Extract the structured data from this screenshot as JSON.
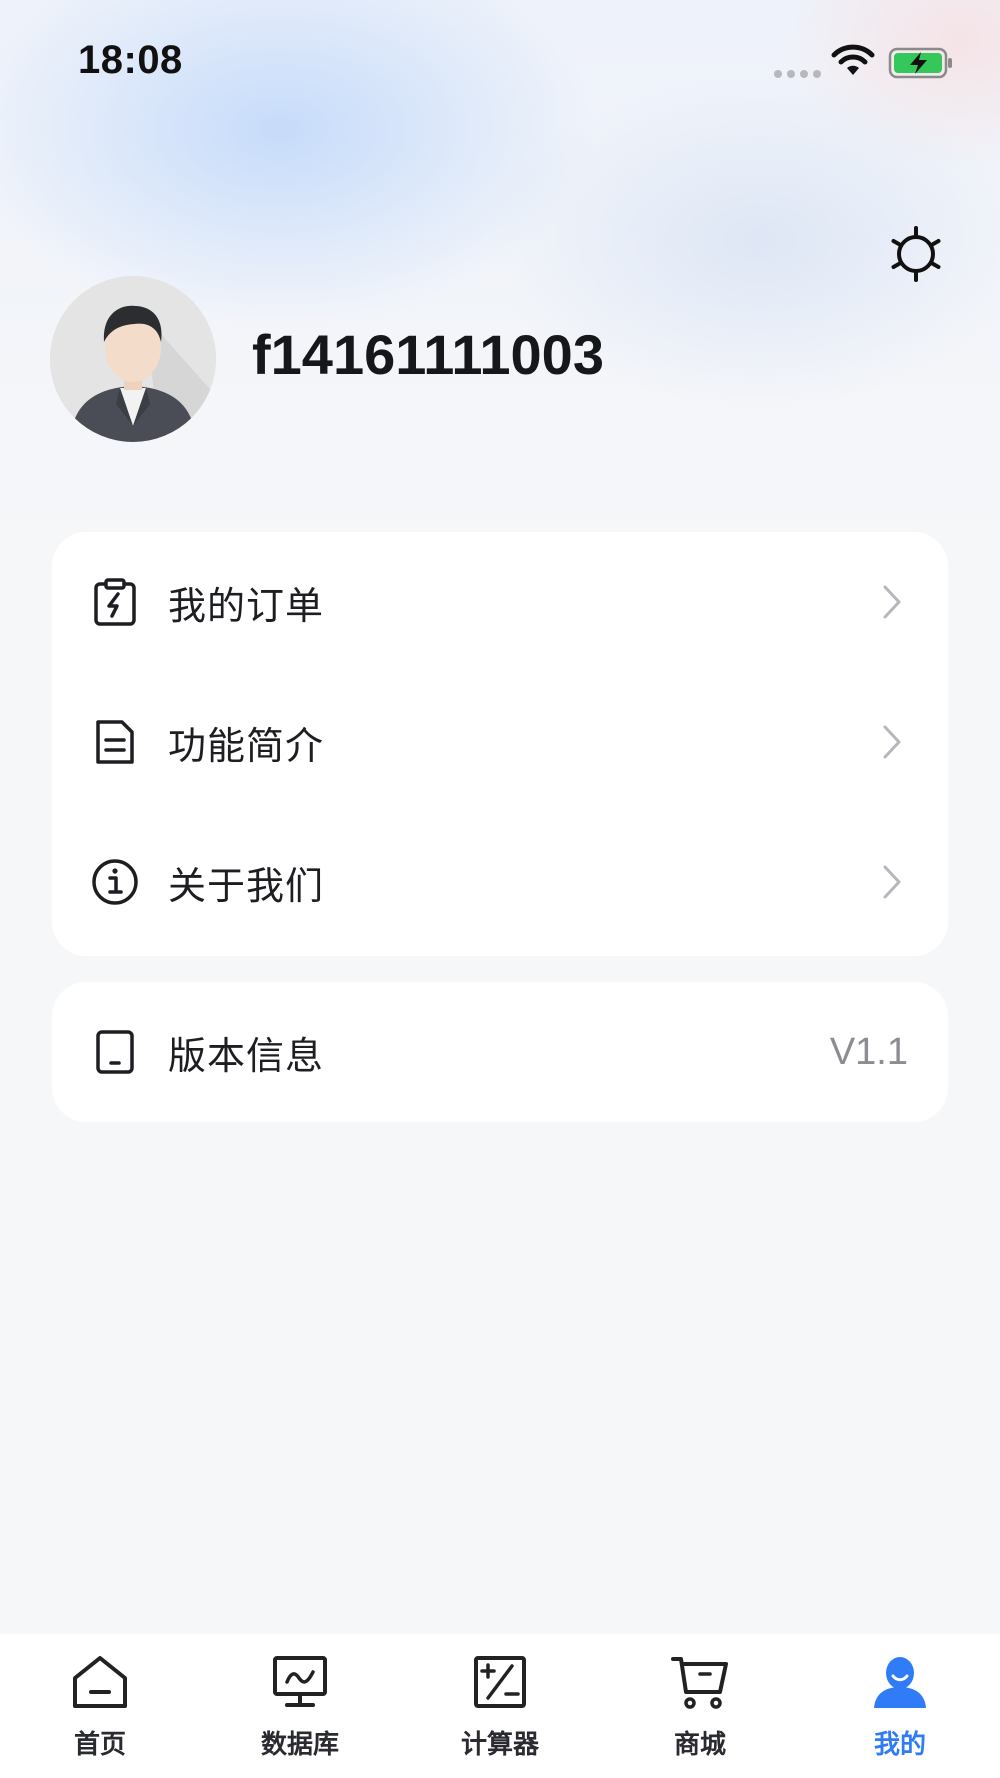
{
  "status_bar": {
    "time": "18:08"
  },
  "header": {
    "settings_icon": "settings-gear-icon"
  },
  "profile": {
    "username": "f14161111003",
    "avatar_icon": "user-avatar"
  },
  "menu": {
    "items": [
      {
        "label": "我的订单",
        "icon": "order-clipboard-icon"
      },
      {
        "label": "功能简介",
        "icon": "document-icon"
      },
      {
        "label": "关于我们",
        "icon": "info-icon"
      }
    ]
  },
  "version": {
    "label": "版本信息",
    "value": "V1.1",
    "icon": "device-icon"
  },
  "tabbar": {
    "tabs": [
      {
        "label": "首页",
        "icon": "home-icon",
        "active": false
      },
      {
        "label": "数据库",
        "icon": "monitor-chart-icon",
        "active": false
      },
      {
        "label": "计算器",
        "icon": "calculator-icon",
        "active": false
      },
      {
        "label": "商城",
        "icon": "cart-icon",
        "active": false
      },
      {
        "label": "我的",
        "icon": "user-icon",
        "active": true
      }
    ],
    "active_color": "#2f7cf6"
  }
}
